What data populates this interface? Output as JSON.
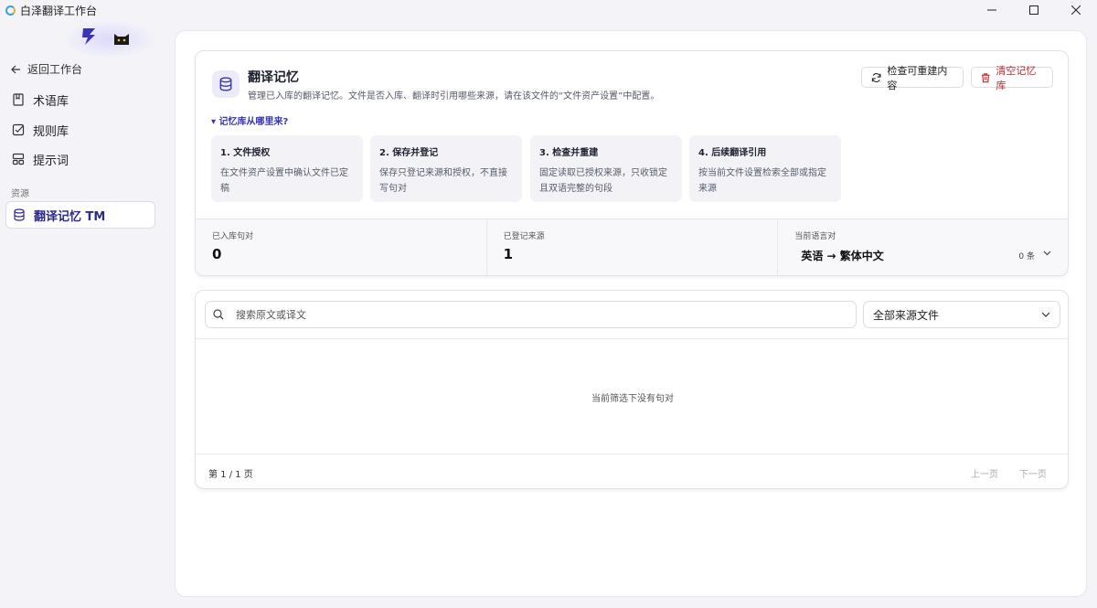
{
  "window": {
    "title": "白泽翻译工作台"
  },
  "sidebar": {
    "back_label": "返回工作台",
    "items": [
      {
        "label": "术语库"
      },
      {
        "label": "规则库"
      },
      {
        "label": "提示词"
      }
    ],
    "section_label": "资源",
    "active_item": {
      "label": "翻译记忆 TM"
    }
  },
  "header": {
    "title": "翻译记忆",
    "description": "管理已入库的翻译记忆。文件是否入库、翻译时引用哪些来源，请在该文件的“文件资产设置”中配置。",
    "check_button": "检查可重建内容",
    "clear_button": "清空记忆库",
    "toggle_label": "▾ 记忆库从哪里来?"
  },
  "steps": [
    {
      "title": "1. 文件授权",
      "desc": "在文件资产设置中确认文件已定稿"
    },
    {
      "title": "2. 保存并登记",
      "desc": "保存只登记来源和授权，不直接写句对"
    },
    {
      "title": "3. 检查并重建",
      "desc": "固定读取已授权来源，只收锁定且双语完整的句段"
    },
    {
      "title": "4. 后续翻译引用",
      "desc": "按当前文件设置检索全部或指定来源"
    }
  ],
  "stats": {
    "sentences": {
      "label": "已入库句对",
      "value": "0"
    },
    "sources": {
      "label": "已登记来源",
      "value": "1"
    },
    "language": {
      "label": "当前语言对",
      "pair": "英语 → 繁体中文",
      "count": "0 条"
    }
  },
  "search": {
    "placeholder": "搜索原文或译文",
    "value": ""
  },
  "filter": {
    "selected": "全部来源文件"
  },
  "empty_state": "当前筛选下没有句对",
  "pagination": {
    "info": "第 1 / 1 页",
    "prev": "上一页",
    "next": "下一页"
  },
  "colors": {
    "accent": "#3a33b8",
    "danger": "#c0262d",
    "background": "#f3f3f8"
  }
}
